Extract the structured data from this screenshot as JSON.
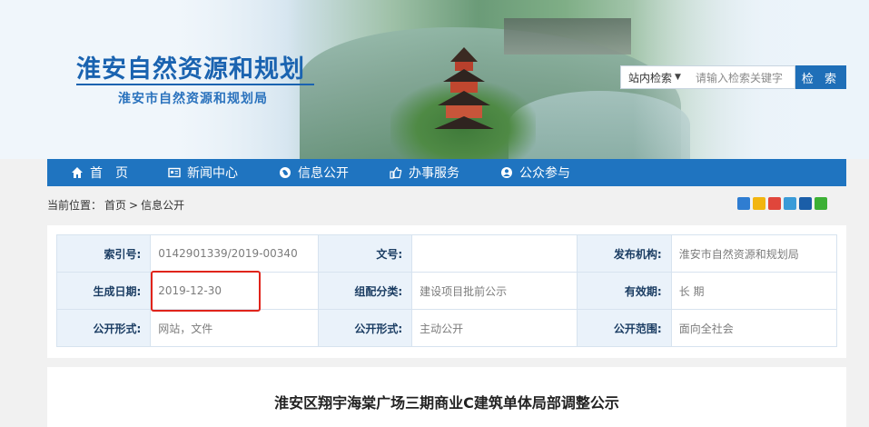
{
  "site": {
    "title": "淮安自然资源和规划",
    "subtitle": "淮安市自然资源和规划局"
  },
  "search": {
    "scope_label": "站内检索",
    "placeholder": "请输入检索关键字",
    "button_label": "检 索"
  },
  "nav": {
    "items": [
      {
        "label": "首　页",
        "icon": "home-icon"
      },
      {
        "label": "新闻中心",
        "icon": "news-icon"
      },
      {
        "label": "信息公开",
        "icon": "globe-icon"
      },
      {
        "label": "办事服务",
        "icon": "thumbs-up-icon"
      },
      {
        "label": "公众参与",
        "icon": "user-icon"
      }
    ]
  },
  "breadcrumb": {
    "prefix": "当前位置：",
    "home": "首页",
    "separator": ">",
    "current": "信息公开"
  },
  "share_icons": [
    "add-icon",
    "qzone-icon",
    "weibo-icon",
    "tencent-icon",
    "renren-icon",
    "wechat-icon"
  ],
  "info": {
    "rows": [
      [
        {
          "key": "索引号:",
          "value": "0142901339/2019-00340"
        },
        {
          "key": "文号:",
          "value": ""
        },
        {
          "key": "发布机构:",
          "value": "淮安市自然资源和规划局"
        }
      ],
      [
        {
          "key": "生成日期:",
          "value": "2019-12-30"
        },
        {
          "key": "组配分类:",
          "value": "建设项目批前公示"
        },
        {
          "key": "有效期:",
          "value": "长 期"
        }
      ],
      [
        {
          "key": "公开形式:",
          "value": "网站，文件"
        },
        {
          "key": "公开形式:",
          "value": "主动公开"
        },
        {
          "key": "公开范围:",
          "value": "面向全社会"
        }
      ]
    ]
  },
  "article": {
    "title": "淮安区翔宇海棠广场三期商业C建筑单体局部调整公示"
  },
  "colors": {
    "nav_bg": "#1f74c0",
    "brand_blue": "#1a63b0",
    "highlight_red": "#e0241b",
    "key_cell_bg": "#eaf2fa"
  }
}
